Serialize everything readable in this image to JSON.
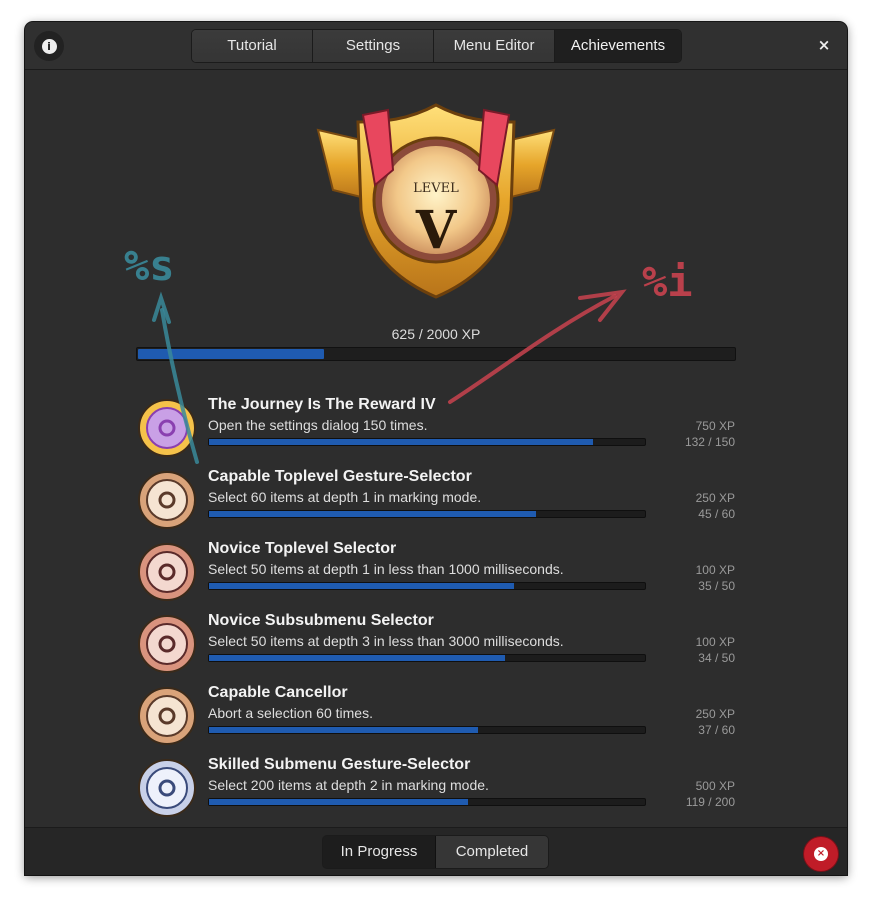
{
  "header": {
    "tabs": [
      "Tutorial",
      "Settings",
      "Menu Editor",
      "Achievements"
    ],
    "active_tab": "Achievements",
    "info_icon": "info-icon",
    "close_icon": "close-icon",
    "close_glyph": "×",
    "info_glyph": "i"
  },
  "level": {
    "label": "LEVEL",
    "numeral": "V",
    "xp_text": "625 / 2000 XP",
    "progress_fraction": 0.3125
  },
  "achievements": [
    {
      "title": "The Journey Is The Reward IV",
      "description": "Open the settings dialog 150 times.",
      "xp": "750 XP",
      "progress": "132 / 150",
      "fraction": 0.88,
      "medal": "gear-medal-gold"
    },
    {
      "title": "Capable Toplevel Gesture-Selector",
      "description": "Select 60 items at depth 1 in marking mode.",
      "xp": "250 XP",
      "progress": "45 / 60",
      "fraction": 0.75,
      "medal": "gesture-medal-bronze"
    },
    {
      "title": "Novice Toplevel Selector",
      "description": "Select 50 items at depth 1 in less than 1000 milliseconds.",
      "xp": "100 XP",
      "progress": "35 / 50",
      "fraction": 0.7,
      "medal": "stopwatch-medal-copper"
    },
    {
      "title": "Novice Subsubmenu Selector",
      "description": "Select 50 items at depth 3 in less than 3000 milliseconds.",
      "xp": "100 XP",
      "progress": "34 / 50",
      "fraction": 0.68,
      "medal": "stopwatch-medal-copper"
    },
    {
      "title": "Capable Cancellor",
      "description": "Abort a selection 60 times.",
      "xp": "250 XP",
      "progress": "37 / 60",
      "fraction": 0.6167,
      "medal": "cancel-medal-bronze"
    },
    {
      "title": "Skilled Submenu Gesture-Selector",
      "description": "Select 200 items at depth 2 in marking mode.",
      "xp": "500 XP",
      "progress": "119 / 200",
      "fraction": 0.595,
      "medal": "gesture-medal-silver"
    }
  ],
  "footer": {
    "switch": [
      "In Progress",
      "Completed"
    ],
    "active": "In Progress",
    "delete_icon": "delete-icon",
    "delete_glyph": "×"
  },
  "annotations": {
    "left_label": "%s",
    "right_label": "%i"
  },
  "colors": {
    "window_bg": "#2d2d2d",
    "progress_blue": "#1f5bb0",
    "destructive_red": "#c01c28",
    "annotation_teal": "#3a8a9a",
    "annotation_red": "#c9434f"
  }
}
